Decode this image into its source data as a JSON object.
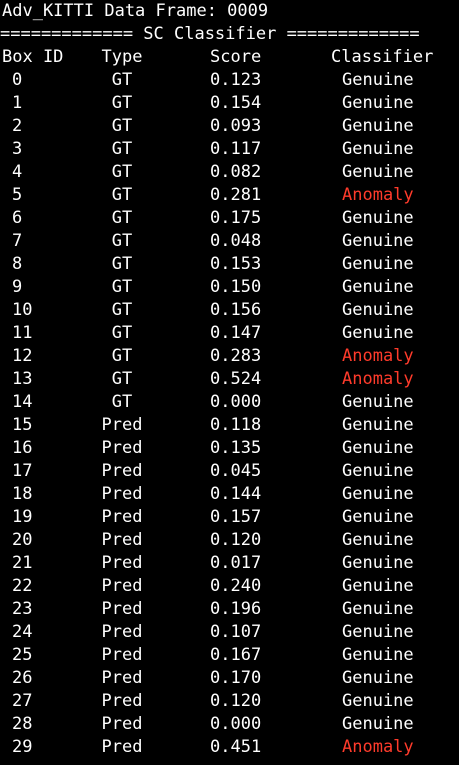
{
  "title": "Adv_KITTI Data Frame: 0009",
  "banner": "============= SC Classifier =============",
  "headers": {
    "box_id": "Box ID",
    "type": "Type",
    "score": "Score",
    "classifier": "Classifier"
  },
  "colors": {
    "background": "#000000",
    "text": "#ffffff",
    "anomaly": "#ff3b2b"
  },
  "rows": [
    {
      "id": "0",
      "type": "GT",
      "score": "0.123",
      "classifier": "Genuine"
    },
    {
      "id": "1",
      "type": "GT",
      "score": "0.154",
      "classifier": "Genuine"
    },
    {
      "id": "2",
      "type": "GT",
      "score": "0.093",
      "classifier": "Genuine"
    },
    {
      "id": "3",
      "type": "GT",
      "score": "0.117",
      "classifier": "Genuine"
    },
    {
      "id": "4",
      "type": "GT",
      "score": "0.082",
      "classifier": "Genuine"
    },
    {
      "id": "5",
      "type": "GT",
      "score": "0.281",
      "classifier": "Anomaly"
    },
    {
      "id": "6",
      "type": "GT",
      "score": "0.175",
      "classifier": "Genuine"
    },
    {
      "id": "7",
      "type": "GT",
      "score": "0.048",
      "classifier": "Genuine"
    },
    {
      "id": "8",
      "type": "GT",
      "score": "0.153",
      "classifier": "Genuine"
    },
    {
      "id": "9",
      "type": "GT",
      "score": "0.150",
      "classifier": "Genuine"
    },
    {
      "id": "10",
      "type": "GT",
      "score": "0.156",
      "classifier": "Genuine"
    },
    {
      "id": "11",
      "type": "GT",
      "score": "0.147",
      "classifier": "Genuine"
    },
    {
      "id": "12",
      "type": "GT",
      "score": "0.283",
      "classifier": "Anomaly"
    },
    {
      "id": "13",
      "type": "GT",
      "score": "0.524",
      "classifier": "Anomaly"
    },
    {
      "id": "14",
      "type": "GT",
      "score": "0.000",
      "classifier": "Genuine"
    },
    {
      "id": "15",
      "type": "Pred",
      "score": "0.118",
      "classifier": "Genuine"
    },
    {
      "id": "16",
      "type": "Pred",
      "score": "0.135",
      "classifier": "Genuine"
    },
    {
      "id": "17",
      "type": "Pred",
      "score": "0.045",
      "classifier": "Genuine"
    },
    {
      "id": "18",
      "type": "Pred",
      "score": "0.144",
      "classifier": "Genuine"
    },
    {
      "id": "19",
      "type": "Pred",
      "score": "0.157",
      "classifier": "Genuine"
    },
    {
      "id": "20",
      "type": "Pred",
      "score": "0.120",
      "classifier": "Genuine"
    },
    {
      "id": "21",
      "type": "Pred",
      "score": "0.017",
      "classifier": "Genuine"
    },
    {
      "id": "22",
      "type": "Pred",
      "score": "0.240",
      "classifier": "Genuine"
    },
    {
      "id": "23",
      "type": "Pred",
      "score": "0.196",
      "classifier": "Genuine"
    },
    {
      "id": "24",
      "type": "Pred",
      "score": "0.107",
      "classifier": "Genuine"
    },
    {
      "id": "25",
      "type": "Pred",
      "score": "0.167",
      "classifier": "Genuine"
    },
    {
      "id": "26",
      "type": "Pred",
      "score": "0.170",
      "classifier": "Genuine"
    },
    {
      "id": "27",
      "type": "Pred",
      "score": "0.120",
      "classifier": "Genuine"
    },
    {
      "id": "28",
      "type": "Pred",
      "score": "0.000",
      "classifier": "Genuine"
    },
    {
      "id": "29",
      "type": "Pred",
      "score": "0.451",
      "classifier": "Anomaly"
    }
  ]
}
